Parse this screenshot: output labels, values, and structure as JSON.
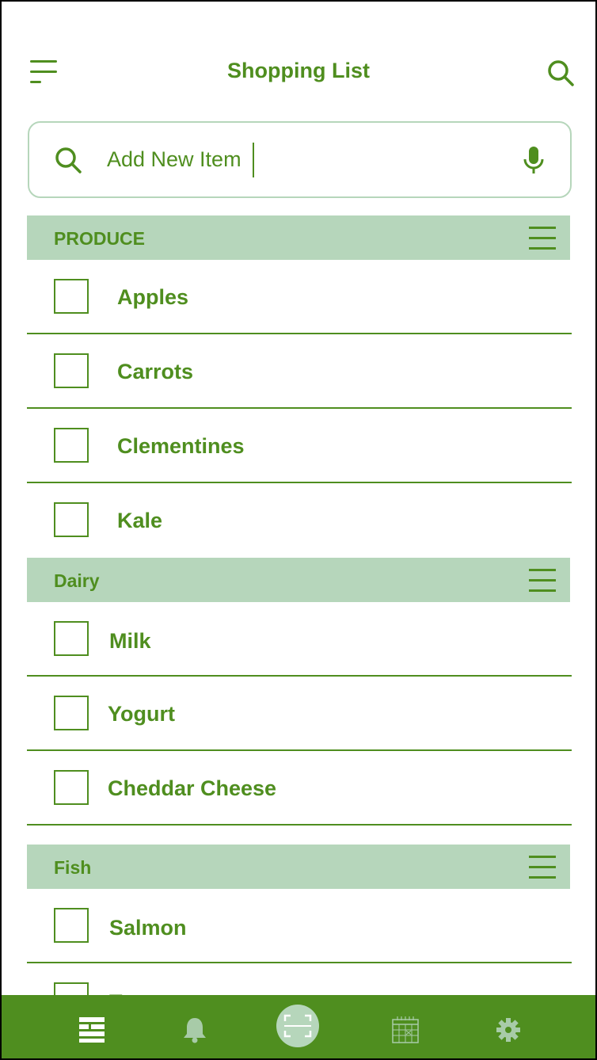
{
  "header": {
    "title": "Shopping List",
    "menu_icon": "hamburger-menu-icon",
    "search_icon": "search-icon"
  },
  "add_item": {
    "placeholder": "Add New Item",
    "search_icon": "search-icon",
    "mic_icon": "microphone-icon"
  },
  "sections": [
    {
      "label": "PRODUCE",
      "items": [
        "Apples",
        "Carrots",
        "Clementines",
        "Kale"
      ]
    },
    {
      "label": "Dairy",
      "items": [
        "Milk",
        "Yogurt",
        "Cheddar Cheese"
      ]
    },
    {
      "label": "Fish",
      "items": [
        "Salmon",
        "Tuna"
      ]
    }
  ],
  "bottom_nav": [
    {
      "icon": "list-icon"
    },
    {
      "icon": "bell-icon"
    },
    {
      "icon": "scan-icon"
    },
    {
      "icon": "calendar-icon"
    },
    {
      "icon": "settings-gear-icon"
    }
  ],
  "colors": {
    "accent": "#4f8e1f",
    "section_bg": "#b6d6bb",
    "icon_muted": "#a8cba8",
    "background": "#ffffff"
  }
}
